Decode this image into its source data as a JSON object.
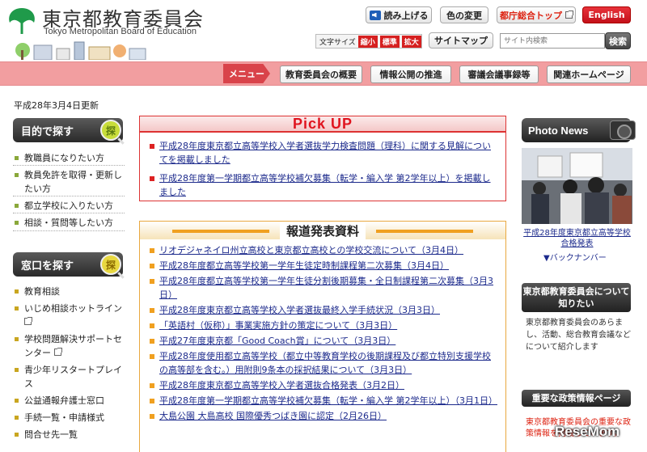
{
  "header": {
    "org_name_ja": "東京都教育委員会",
    "org_name_en": "Tokyo Metropolitan Board of Education",
    "read_aloud_label": "読み上げる",
    "color_change_label": "色の変更",
    "gov_top_label": "都庁総合トップ",
    "english_label": "English",
    "font_size_label": "文字サイズ",
    "font_small": "縮小",
    "font_standard": "標準",
    "font_large": "拡大",
    "sitemap_label": "サイトマップ",
    "search_placeholder": "サイト内検索",
    "search_button": "検索"
  },
  "nav": {
    "menu_label": "メニュー",
    "items": [
      "教育委員会の概要",
      "情報公開の推進",
      "審議会議事録等",
      "関連ホームページ"
    ]
  },
  "updated": "平成28年3月4日更新",
  "sidebar": {
    "purpose_title": "目的で探す",
    "purpose_badge": "探",
    "purpose_items": [
      "教職員になりたい方",
      "教員免許を取得・更新したい方",
      "都立学校に入りたい方",
      "相談・質問等したい方"
    ],
    "window_title": "窓口を探す",
    "window_badge": "探",
    "window_items": [
      "教育相談",
      "いじめ相談ホットライン",
      "学校問題解決サポートセンター",
      "青少年リスタートプレイス",
      "公益通報弁護士窓口",
      "手続一覧・申請様式",
      "問合せ先一覧"
    ]
  },
  "pickup": {
    "title": "Pick UP",
    "items": [
      "平成28年度東京都立高等学校入学者選抜学力検査問題（理科）に関する見解についてを掲載しました",
      "平成28年度第一学期都立高等学校補欠募集（転学・編入学 第2学年以上）を掲載しました"
    ]
  },
  "press": {
    "title": "報道発表資料",
    "items": [
      "リオデジャネイロ州立高校と東京都立高校との学校交流について（3月4日）",
      "平成28年度都立高等学校第一学年生徒定時制課程第二次募集（3月4日）",
      "平成28年度都立高等学校第一学年生徒分割後期募集・全日制課程第二次募集（3月3日）",
      "平成28年度東京都立高等学校入学者選抜最終入学手続状況（3月3日）",
      "「英語村（仮称）」事業実施方針の策定について（3月3日）",
      "平成27年度東京都「Good Coach賞」について（3月3日）",
      "平成28年度使用都立高等学校（都立中等教育学校の後期課程及び都立特別支援学校の高等部を含む。）用附則9条本の採択結果について（3月3日）",
      "平成28年度東京都立高等学校入学者選抜合格発表（3月2日）",
      "平成28年度第一学期都立高等学校補欠募集（転学・編入学 第2学年以上）（3月1日）",
      "大島公園 大島高校 国際優秀つばき園に認定（2月26日）"
    ]
  },
  "photo_news": {
    "title": "Photo News",
    "caption": "平成28年度東京都立高等学校合格発表",
    "back_numbers": "▼バックナンバー"
  },
  "board_box": {
    "title": "東京都教育委員会について知りたい",
    "desc": "東京都教育委員会のあらまし、活動、総合教育会議などについて紹介します"
  },
  "policy_box": {
    "title": "重要な政策情報ページ",
    "text": "東京都教育委員会の重要な政策情報を掲載しています。"
  },
  "watermark": "ReseMom"
}
